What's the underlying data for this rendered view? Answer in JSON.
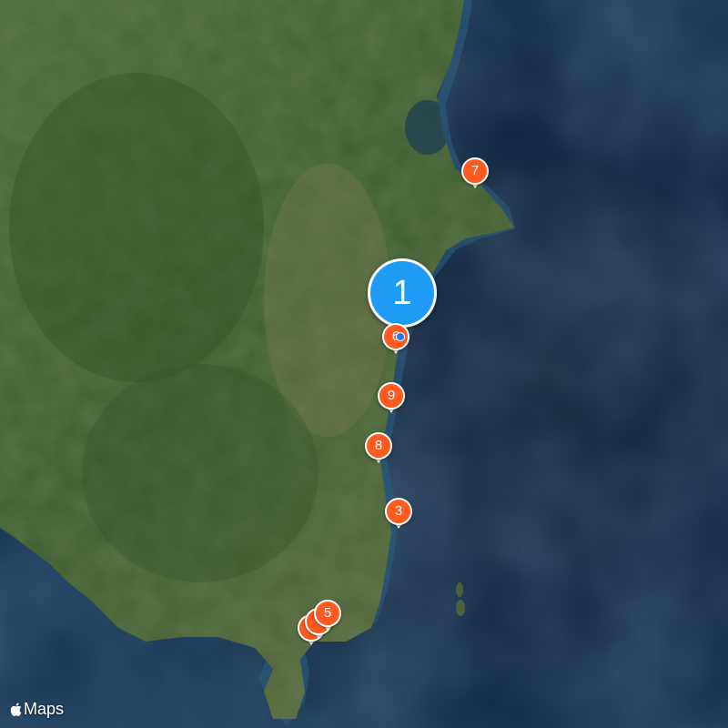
{
  "map": {
    "type": "satellite",
    "attribution_logo": "apple-logo-icon",
    "attribution_text": "Maps",
    "colors": {
      "pin": "#ff5a1f",
      "cluster": "#1d9bf5",
      "pin_border": "#ffffff",
      "water": "#0c2038",
      "land": "#3c5a2e"
    }
  },
  "cluster": {
    "label": "1"
  },
  "pins": [
    {
      "id": "pin-7",
      "label": "7"
    },
    {
      "id": "pin-6",
      "label": "6"
    },
    {
      "id": "pin-9",
      "label": "9"
    },
    {
      "id": "pin-8",
      "label": "8"
    },
    {
      "id": "pin-3",
      "label": "3"
    },
    {
      "id": "pin-5",
      "label": "5"
    },
    {
      "id": "pin-stack-a",
      "label": ""
    },
    {
      "id": "pin-stack-b",
      "label": ""
    }
  ],
  "user_location": {
    "icon": "current-location-dot-icon"
  }
}
